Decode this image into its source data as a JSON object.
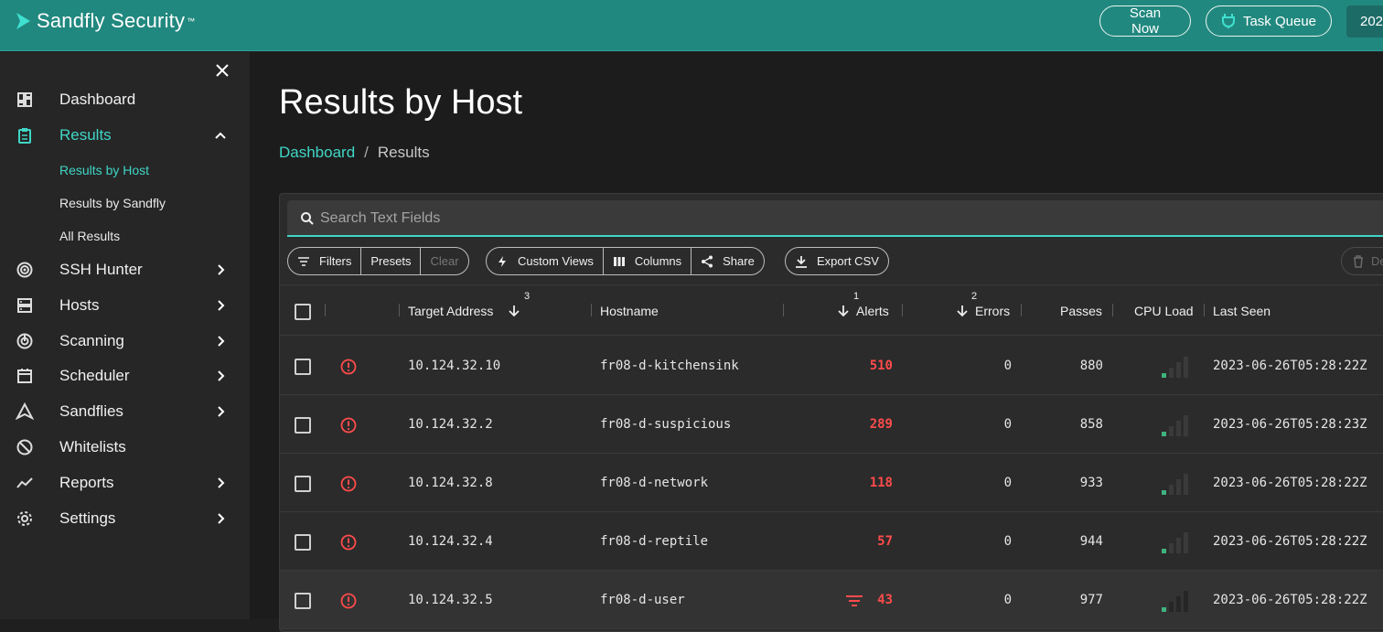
{
  "brand": {
    "name": "Sandfly Security",
    "tm": "™"
  },
  "topbar": {
    "scan_label": "Scan Now",
    "queue_label": "Task Queue",
    "date_partial": "202"
  },
  "sidebar": {
    "items": [
      {
        "label": "Dashboard",
        "icon": "dashboard-icon"
      },
      {
        "label": "Results",
        "icon": "clipboard-icon",
        "expanded": true
      },
      {
        "label": "SSH Hunter",
        "icon": "target-icon"
      },
      {
        "label": "Hosts",
        "icon": "server-icon"
      },
      {
        "label": "Scanning",
        "icon": "radar-icon"
      },
      {
        "label": "Scheduler",
        "icon": "calendar-icon"
      },
      {
        "label": "Sandflies",
        "icon": "sandfly-icon"
      },
      {
        "label": "Whitelists",
        "icon": "block-icon"
      },
      {
        "label": "Reports",
        "icon": "chart-line-icon"
      },
      {
        "label": "Settings",
        "icon": "gear-icon"
      }
    ],
    "sub_items": [
      "Results by Host",
      "Results by Sandfly",
      "All Results"
    ]
  },
  "page": {
    "title": "Results by Host",
    "breadcrumb": {
      "home": "Dashboard",
      "sep": "/",
      "current": "Results"
    }
  },
  "search": {
    "placeholder": "Search Text Fields"
  },
  "toolbar": {
    "filters": "Filters",
    "presets": "Presets",
    "clear": "Clear",
    "custom_views": "Custom Views",
    "columns": "Columns",
    "share": "Share",
    "export_csv": "Export CSV",
    "delete_partial": "De"
  },
  "table": {
    "headers": {
      "target": "Target Address",
      "hostname": "Hostname",
      "alerts": "Alerts",
      "errors": "Errors",
      "passes": "Passes",
      "cpu": "CPU Load",
      "last_seen": "Last Seen"
    },
    "sort_order": {
      "alerts": "1",
      "errors": "2",
      "target": "3"
    },
    "rows": [
      {
        "address": "10.124.32.10",
        "hostname": "fr08-d-kitchensink",
        "alerts": "510",
        "errors": "0",
        "passes": "880",
        "cpu_level": 1,
        "last_seen": "2023-06-26T05:28:22Z"
      },
      {
        "address": "10.124.32.2",
        "hostname": "fr08-d-suspicious",
        "alerts": "289",
        "errors": "0",
        "passes": "858",
        "cpu_level": 1,
        "last_seen": "2023-06-26T05:28:23Z"
      },
      {
        "address": "10.124.32.8",
        "hostname": "fr08-d-network",
        "alerts": "118",
        "errors": "0",
        "passes": "933",
        "cpu_level": 1,
        "last_seen": "2023-06-26T05:28:22Z"
      },
      {
        "address": "10.124.32.4",
        "hostname": "fr08-d-reptile",
        "alerts": "57",
        "errors": "0",
        "passes": "944",
        "cpu_level": 1,
        "last_seen": "2023-06-26T05:28:22Z"
      },
      {
        "address": "10.124.32.5",
        "hostname": "fr08-d-user",
        "alerts": "43",
        "errors": "0",
        "passes": "977",
        "cpu_level": 1,
        "last_seen": "2023-06-26T05:28:22Z"
      }
    ]
  },
  "colors": {
    "accent": "#3fd6c6",
    "topbar": "#21887f",
    "alert": "#ff4b4b",
    "cpu_active": "#3fb37f",
    "cpu_idle": "#3a3a3a"
  }
}
